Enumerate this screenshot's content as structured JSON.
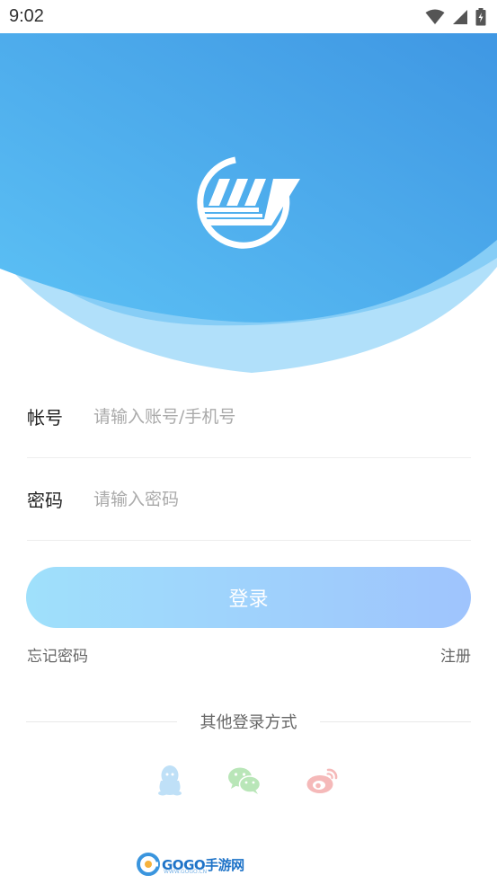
{
  "status_bar": {
    "time": "9:02",
    "icons": [
      "wifi-icon",
      "signal-icon",
      "battery-charging-icon"
    ]
  },
  "header": {
    "colors": {
      "top": "#3f9be4",
      "bottom": "#56b9f2",
      "wave": "#a7dcf8"
    },
    "logo_icon": "app-logo-icon"
  },
  "form": {
    "account": {
      "label": "帐号",
      "placeholder": "请输入账号/手机号",
      "value": ""
    },
    "password": {
      "label": "密码",
      "placeholder": "请输入密码",
      "value": ""
    }
  },
  "login_button": {
    "label": "登录"
  },
  "links": {
    "forgot_password": "忘记密码",
    "register": "注册"
  },
  "other_login": {
    "title": "其他登录方式",
    "methods": [
      {
        "name": "qq",
        "icon": "qq-icon",
        "color": "#bfe0f7"
      },
      {
        "name": "wechat",
        "icon": "wechat-icon",
        "color": "#b9e6b8"
      },
      {
        "name": "weibo",
        "icon": "weibo-icon",
        "color": "#f5b9b9"
      }
    ]
  },
  "watermark": {
    "text": "GOGO手游网",
    "url": "WWW.GOGO.CN"
  }
}
